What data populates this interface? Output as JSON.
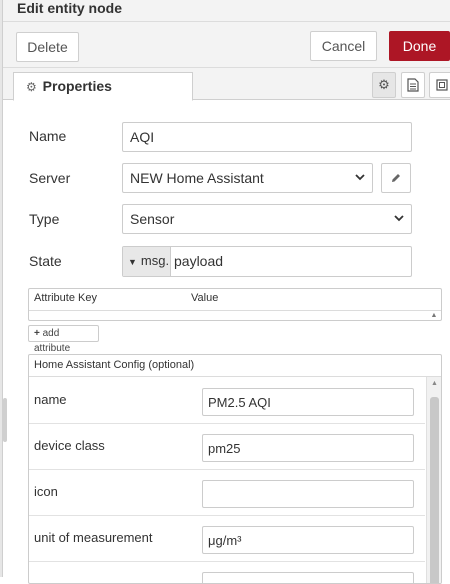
{
  "title": "Edit entity node",
  "toolbar": {
    "delete": "Delete",
    "cancel": "Cancel",
    "done": "Done"
  },
  "tabs": {
    "properties": "Properties"
  },
  "icons": {
    "properties_tab": "gear-icon",
    "settings_tab": "gear-icon",
    "description_tab": "document-icon",
    "appearance_tab": "appearance-icon",
    "server_edit": "pencil-icon",
    "dropdown": "chevron-down-icon",
    "typed_caret": "caret-down-icon",
    "add": "plus-icon"
  },
  "form": {
    "name": {
      "label": "Name",
      "value": "AQI"
    },
    "server": {
      "label": "Server",
      "value": "NEW Home Assistant"
    },
    "type": {
      "label": "Type",
      "value": "Sensor"
    },
    "state": {
      "label": "State",
      "type_label": "msg.",
      "value": "payload"
    }
  },
  "attributes": {
    "col_key": "Attribute Key",
    "col_value": "Value",
    "add_label": "add attribute"
  },
  "ha_config": {
    "title": "Home Assistant Config (optional)",
    "rows": [
      {
        "label": "name",
        "value": "PM2.5 AQI"
      },
      {
        "label": "device class",
        "value": "pm25"
      },
      {
        "label": "icon",
        "value": ""
      },
      {
        "label": "unit of measurement",
        "value": "μg/m³"
      }
    ]
  },
  "colors": {
    "done_button": "#ad1625",
    "border": "#cccccc",
    "tray_bg": "#f3f3f3"
  }
}
